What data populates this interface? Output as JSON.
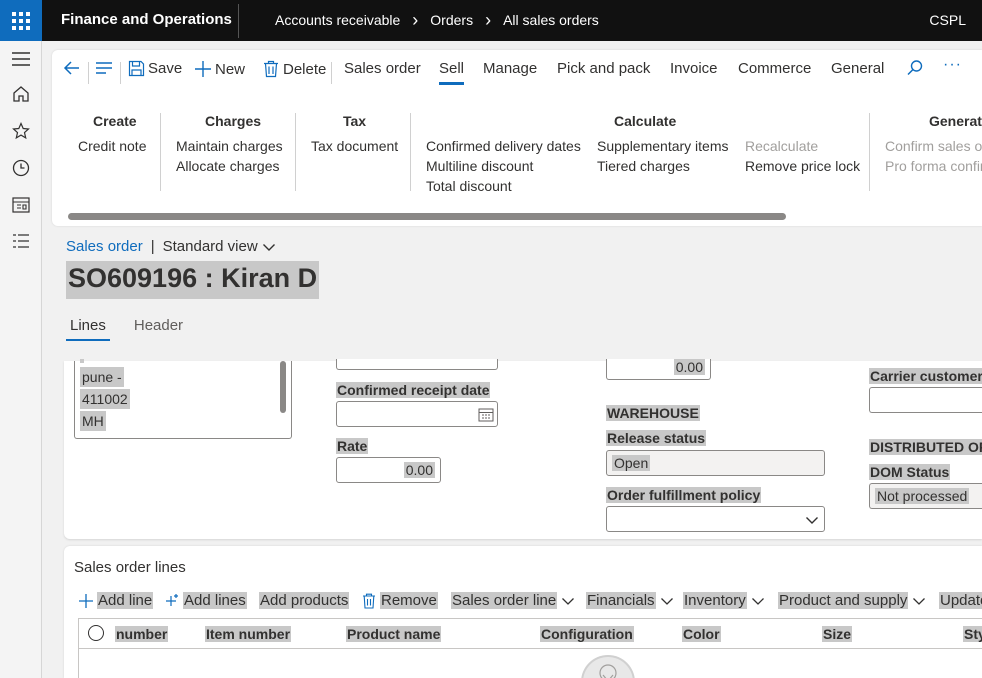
{
  "topbar": {
    "app_title": "Finance and Operations",
    "breadcrumbs": [
      "Accounts receivable",
      "Orders",
      "All sales orders"
    ],
    "company": "CSPL"
  },
  "leftnav": {
    "icons": [
      "hamburger-icon",
      "home-icon",
      "star-icon",
      "clock-icon",
      "workspace-icon",
      "list-icon"
    ]
  },
  "actionbar": {
    "save": "Save",
    "new": "New",
    "delete": "Delete",
    "tabs": [
      "Sales order",
      "Sell",
      "Manage",
      "Pick and pack",
      "Invoice",
      "Commerce",
      "General"
    ],
    "active_tab": "Sell",
    "more": "···"
  },
  "groups": {
    "create": {
      "title": "Create",
      "items": [
        "Credit note"
      ]
    },
    "charges": {
      "title": "Charges",
      "items": [
        "Maintain charges",
        "Allocate charges"
      ]
    },
    "tax": {
      "title": "Tax",
      "items": [
        "Tax document"
      ]
    },
    "calculate": {
      "title": "Calculate",
      "col1": [
        "Confirmed delivery dates",
        "Multiline discount",
        "Total discount"
      ],
      "col2": [
        "Supplementary items",
        "Tiered charges"
      ],
      "col3_disabled": "Recalculate",
      "col3": "Remove price lock"
    },
    "generate": {
      "title": "Generate",
      "items": [
        "Confirm sales or",
        "Pro forma confir"
      ]
    }
  },
  "form": {
    "crumb_link": "Sales order",
    "view": "Standard view",
    "title": "SO609196 : Kiran D",
    "tabs": [
      "Lines",
      "Header"
    ],
    "active_tab": "Lines"
  },
  "details": {
    "address_lines": [
      "pune -",
      "411002",
      "MH"
    ],
    "confirmed_receipt_label": "Confirmed receipt date",
    "rate_label": "Rate",
    "rate_value": "0.00",
    "top_amount": "0.00",
    "warehouse_head": "WAREHOUSE",
    "release_status_label": "Release status",
    "release_status_value": "Open",
    "fulfillment_label": "Order fulfillment policy",
    "carrier_label": "Carrier customer a",
    "distributed_head": "DISTRIBUTED ORI",
    "dom_status_label": "DOM Status",
    "dom_status_value": "Not processed"
  },
  "lines": {
    "title": "Sales order lines",
    "toolbar": [
      "Add line",
      "Add lines",
      "Add products",
      "Remove",
      "Sales order line",
      "Financials",
      "Inventory",
      "Product and supply",
      "Update"
    ],
    "columns": [
      "number",
      "Item number",
      "Product name",
      "Configuration",
      "Color",
      "Size",
      "Sty"
    ]
  },
  "colors": {
    "accent": "#0f6cbd",
    "topbar": "#111111",
    "highlight": "#c8c8c8"
  }
}
